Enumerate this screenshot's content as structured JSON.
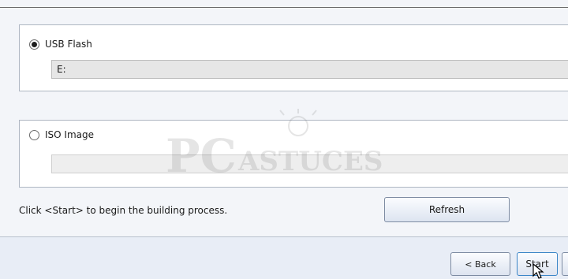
{
  "usb": {
    "label": "USB Flash",
    "value": "E:",
    "selected": true
  },
  "iso": {
    "label": "ISO Image",
    "value": "",
    "selected": false
  },
  "hint": "Click <Start> to begin the building process.",
  "buttons": {
    "refresh": "Refresh",
    "back": "< Back",
    "start": "Start"
  },
  "watermark": {
    "text": "PCASTUCES"
  },
  "icons": {
    "cursor": "mouse-pointer-icon",
    "radio_on": "radio-selected-icon",
    "radio_off": "radio-unselected-icon"
  },
  "colors": {
    "accent": "#3a85c7",
    "border": "#aeb6c2",
    "field": "#e6e6e6"
  }
}
